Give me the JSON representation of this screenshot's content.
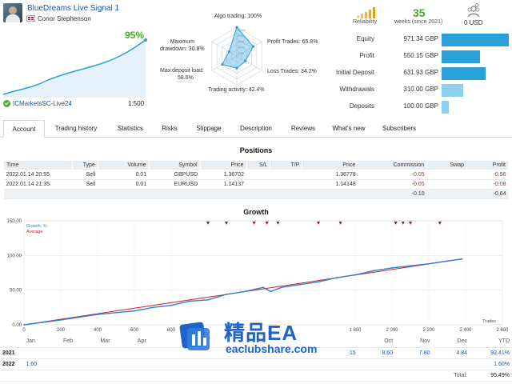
{
  "header": {
    "title": "BlueDreams Live Signal 1",
    "author": "Conor Stephenson",
    "growth": "95%",
    "broker": "ICMarketsSC-Live24",
    "leverage": "1:500"
  },
  "radar": {
    "algo": "Algo trading: 100%",
    "profit_trades": "Profit Trades: 65.8%",
    "loss_trades": "Loss Trades: 34.2%",
    "trading_activity": "Trading activity: 42.4%",
    "max_deposit_load_1": "Max deposit load:",
    "max_deposit_load_2": "58.6%",
    "max_drawdown_1": "Maximum",
    "max_drawdown_2": "drawdown: 30.8%",
    "scale": [
      "100%",
      "80%",
      "60%",
      "40%",
      "20%"
    ],
    "values": {
      "algo": 100,
      "profit_trades": 65.8,
      "loss_trades": 34.2,
      "trading_activity": 42.4,
      "max_deposit_load": 58.6,
      "max_drawdown": 30.8
    }
  },
  "summary": {
    "reliability_label": "Reliability",
    "weeks": "35",
    "weeks_label": "weeks (since 2021)",
    "subscribers": "0",
    "price": "0 USD",
    "accent": "#2a9fd8"
  },
  "stats": [
    {
      "label": "Equity",
      "value": "971.34 GBP",
      "fill": 1.0,
      "color": "#2a9fd8"
    },
    {
      "label": "Profit",
      "value": "550.15 GBP",
      "fill": 0.566,
      "color": "#2a9fd8"
    },
    {
      "label": "Initial Deposit",
      "value": "631.93 GBP",
      "fill": 0.65,
      "color": "#2a9fd8"
    },
    {
      "label": "Withdrawals",
      "value": "310.00 GBP",
      "fill": 0.319,
      "color": "#8fd0ee"
    },
    {
      "label": "Deposits",
      "value": "100.00 GBP",
      "fill": 0.103,
      "color": "#8fd0ee"
    }
  ],
  "tabs": [
    {
      "label": "Account",
      "active": true
    },
    {
      "label": "Trading history"
    },
    {
      "label": "Statistics"
    },
    {
      "label": "Risks"
    },
    {
      "label": "Slippage"
    },
    {
      "label": "Description"
    },
    {
      "label": "Reviews"
    },
    {
      "label": "What's new"
    },
    {
      "label": "Subscribers"
    }
  ],
  "positions": {
    "title": "Positions",
    "headers": [
      "Time",
      "Type",
      "Volume",
      "Symbol",
      "Price",
      "S/L",
      "T/P",
      "Price",
      "Commission",
      "Swap",
      "Profit"
    ],
    "rows": [
      [
        "2022.01.14 20:55",
        "Sell",
        "0.01",
        "GBPUSD",
        "1.36702",
        "",
        "",
        "1.36778",
        "-0.05",
        "",
        "-0.56"
      ],
      [
        "2022.01.14 21:35",
        "Sell",
        "0.01",
        "EURUSD",
        "1.14137",
        "",
        "",
        "1.14148",
        "-0.05",
        "",
        "-0.08"
      ]
    ],
    "totals": {
      "commission": "-0.10",
      "profit": "-0.64"
    }
  },
  "growth": {
    "title": "Growth",
    "legend_growth": "Growth, %",
    "legend_average": "Average",
    "trades_label": "Trades",
    "y_ticks": [
      "150.00",
      "100.00",
      "50.00",
      "0.00"
    ],
    "x_ticks": [
      "0",
      "200",
      "400",
      "600",
      "800",
      "1 800",
      "2 000",
      "2 200",
      "2 400",
      "2 600"
    ],
    "growth_color": "#2a7fd8",
    "average_color": "#d01b1b"
  },
  "chart_data": {
    "type": "line",
    "title": "Growth",
    "xlabel": "Trades",
    "ylabel": "",
    "xlim": [
      0,
      2600
    ],
    "ylim": [
      0,
      150
    ],
    "grid": true,
    "legend": "top-left",
    "series": [
      {
        "name": "Growth, %",
        "x": [
          0,
          200,
          400,
          600,
          700,
          800,
          900,
          1000,
          1100,
          1200,
          1300,
          1340,
          1400,
          1500,
          1600,
          1700,
          1800,
          1900,
          2000,
          2100,
          2200,
          2300,
          2380
        ],
        "y": [
          0,
          7,
          15,
          20,
          25,
          28,
          34,
          36,
          44,
          48,
          54,
          48,
          54,
          58,
          62,
          68,
          72,
          78,
          82,
          85,
          88,
          92,
          95
        ]
      },
      {
        "name": "Average",
        "x": [
          0,
          2380
        ],
        "y": [
          0,
          95
        ]
      }
    ]
  },
  "yearly": {
    "months": [
      "Jan",
      "Feb",
      "Mar",
      "Apr",
      "",
      "",
      "",
      "",
      "",
      "Oct",
      "Nov",
      "Dec",
      "YTD"
    ],
    "rows": [
      {
        "year": "2021",
        "cells": [
          "",
          "",
          "",
          "",
          "",
          "",
          "",
          "",
          "15",
          "8.60",
          "7.80",
          "4.84"
        ],
        "ytd": "92.41%"
      },
      {
        "year": "2022",
        "cells": [
          "1.60",
          "",
          "",
          "",
          "",
          "",
          "",
          "",
          "",
          "",
          "",
          ""
        ],
        "ytd": "1.60%"
      }
    ],
    "total_label": "Total:",
    "total": "95.49%"
  },
  "watermark": {
    "cn": "精品EA",
    "url": "eaclubshare.com"
  }
}
